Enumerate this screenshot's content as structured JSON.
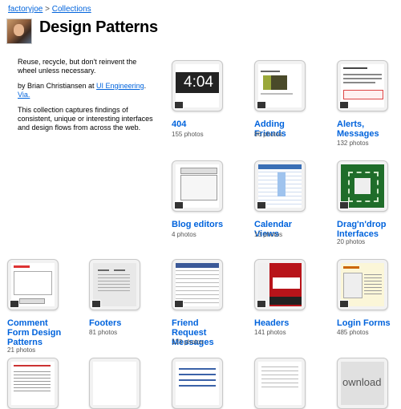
{
  "breadcrumb": {
    "user": "factoryjoe",
    "separator": " > ",
    "section": "Collections"
  },
  "title": "Design Patterns",
  "description": {
    "tagline": "Reuse, recycle, but don't reinvent the wheel unless necessary.",
    "byline_prefix": "by Brian Christiansen at ",
    "byline_link": "UI Engineering",
    "via": "Via.",
    "body": "This collection captures findings of consistent, unique or interesting interfaces and design flows from across the web."
  },
  "sets": [
    {
      "name": "404",
      "count": "155 photos",
      "thumb_text": "4:04"
    },
    {
      "name": "Adding Friends",
      "count": "86 photos"
    },
    {
      "name": "Alerts, Messages",
      "count": "132 photos"
    },
    {
      "name": "Blog editors",
      "count": "4 photos"
    },
    {
      "name": "Calendar Views",
      "count": "13 photos"
    },
    {
      "name": "Drag'n'drop Interfaces",
      "count": "20 photos"
    },
    {
      "name": "Comment Form Design Patterns",
      "count": "21 photos"
    },
    {
      "name": "Footers",
      "count": "81 photos"
    },
    {
      "name": "Friend Request Messages",
      "count": "123 photos"
    },
    {
      "name": "Headers",
      "count": "141 photos"
    },
    {
      "name": "Login Forms",
      "count": "485 photos"
    }
  ],
  "bottom_row_thumb_text": "ownload"
}
